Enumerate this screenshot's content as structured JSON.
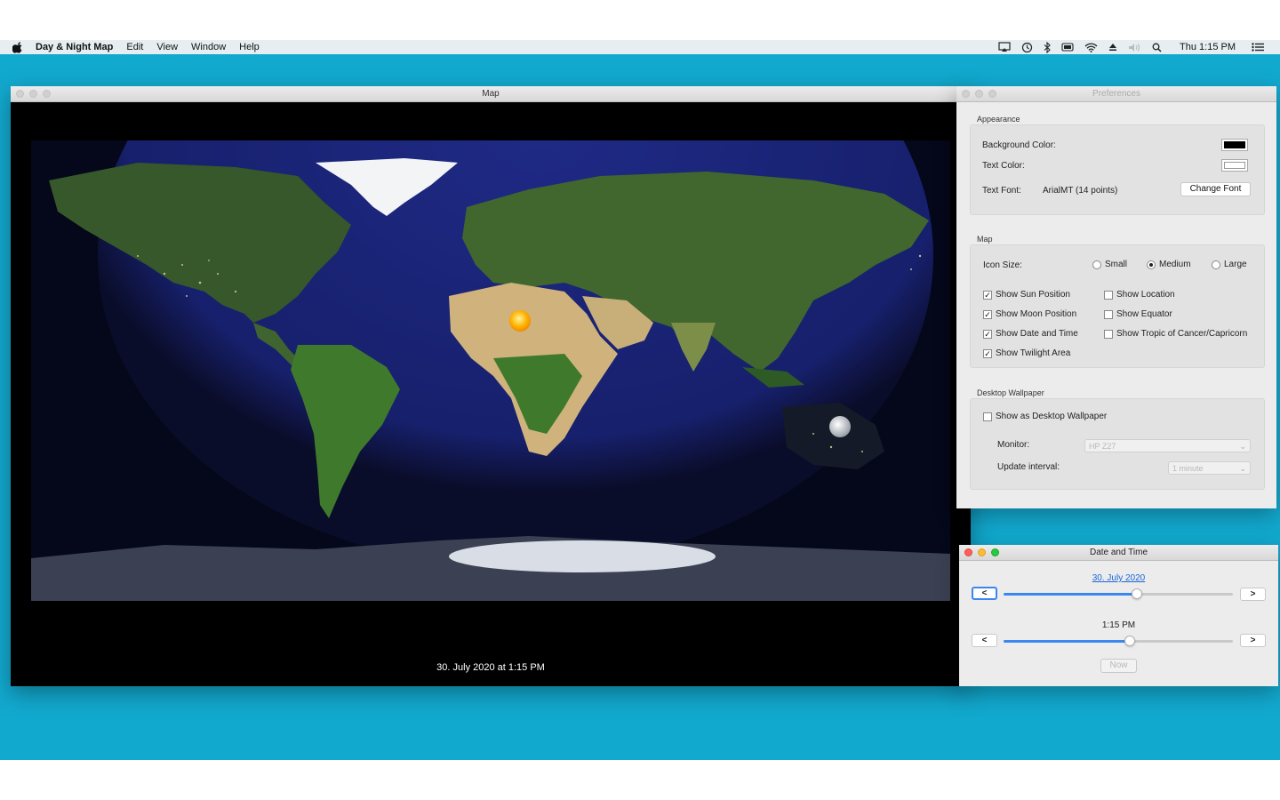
{
  "menubar": {
    "app_name": "Day & Night Map",
    "items": [
      "Edit",
      "View",
      "Window",
      "Help"
    ],
    "clock": "Thu 1:15 PM",
    "status_icons": [
      "airplay-icon",
      "time-machine-icon",
      "bluetooth-icon",
      "battery-icon",
      "wifi-icon",
      "eject-icon",
      "volume-icon",
      "spotlight-icon"
    ]
  },
  "map_window": {
    "title": "Map",
    "caption": "30. July 2020 at 1:15 PM"
  },
  "preferences": {
    "title": "Preferences",
    "appearance": {
      "section_title": "Appearance",
      "background_label": "Background Color:",
      "background_color": "#000000",
      "text_color_label": "Text Color:",
      "text_color": "#ffffff",
      "font_label": "Text Font:",
      "font_value": "ArialMT (14 points)",
      "change_font_button": "Change Font"
    },
    "map": {
      "section_title": "Map",
      "icon_size_label": "Icon Size:",
      "icon_sizes": [
        "Small",
        "Medium",
        "Large"
      ],
      "icon_size_selected": "Medium",
      "checks_left": [
        {
          "label": "Show Sun Position",
          "checked": true
        },
        {
          "label": "Show Moon Position",
          "checked": true
        },
        {
          "label": "Show Date and Time",
          "checked": true
        },
        {
          "label": "Show Twilight Area",
          "checked": true
        }
      ],
      "checks_right": [
        {
          "label": "Show Location",
          "checked": false
        },
        {
          "label": "Show Equator",
          "checked": false
        },
        {
          "label": "Show Tropic of Cancer/Capricorn",
          "checked": false
        }
      ]
    },
    "wallpaper": {
      "section_title": "Desktop Wallpaper",
      "show_label": "Show as Desktop Wallpaper",
      "show_checked": false,
      "monitor_label": "Monitor:",
      "monitor_value": "HP Z27",
      "interval_label": "Update interval:",
      "interval_value": "1 minute"
    }
  },
  "date_time": {
    "title": "Date and Time",
    "date_link": "30. July 2020",
    "time_label": "1:15 PM",
    "prev_label": "<",
    "next_label": ">",
    "date_slider_value": 0.58,
    "time_slider_value": 0.55,
    "now_button": "Now"
  }
}
